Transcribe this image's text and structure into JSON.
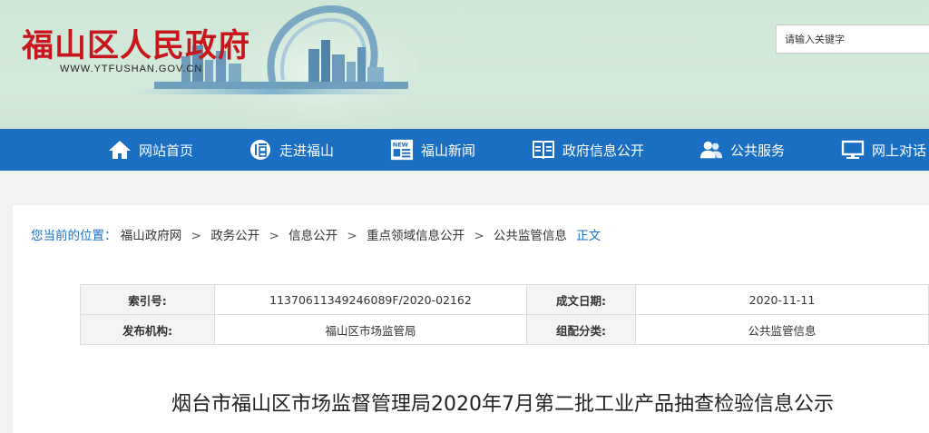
{
  "header": {
    "title": "福山区人民政府",
    "domain": "WWW.YTFUSHAN.GOV.CN",
    "search_placeholder": "请输入关键字"
  },
  "nav": {
    "items": [
      {
        "label": "网站首页",
        "icon": "home-icon"
      },
      {
        "label": "走进福山",
        "icon": "fu-emblem-icon"
      },
      {
        "label": "福山新闻",
        "icon": "news-icon"
      },
      {
        "label": "政府信息公开",
        "icon": "book-icon"
      },
      {
        "label": "公共服务",
        "icon": "people-icon"
      },
      {
        "label": "网上对话",
        "icon": "monitor-icon"
      }
    ]
  },
  "breadcrumb": {
    "lead": "您当前的位置：",
    "items": [
      "福山政府网",
      "政务公开",
      "信息公开",
      "重点领域信息公开",
      "公共监管信息"
    ],
    "current": "正文"
  },
  "meta": {
    "index_label": "索引号:",
    "index_value": "11370611349246089F/2020-02162",
    "date_label": "成文日期:",
    "date_value": "2020-11-11",
    "publisher_label": "发布机构:",
    "publisher_value": "福山区市场监管局",
    "category_label": "组配分类:",
    "category_value": "公共监管信息"
  },
  "article": {
    "title": "烟台市福山区市场监督管理局2020年7月第二批工业产品抽查检验信息公示"
  },
  "colors": {
    "brand_red": "#c8161d",
    "nav_blue": "#1a6fc2",
    "header_green": "#cfe7d6"
  }
}
